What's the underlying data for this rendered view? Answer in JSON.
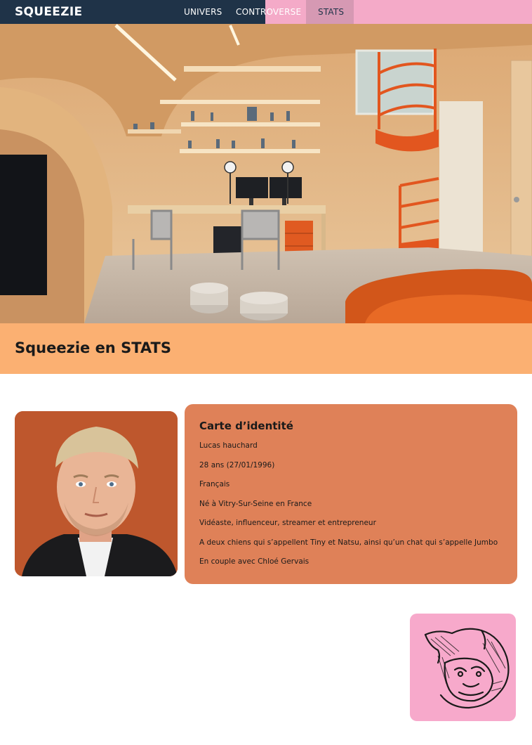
{
  "nav": {
    "brand": "SQUEEZIE",
    "links": [
      {
        "label": "UNIVERS"
      },
      {
        "label": "CONTROVERSE"
      },
      {
        "label": "STATS"
      }
    ],
    "active_link": "STATS"
  },
  "hero": {
    "image_alt": "room-photo"
  },
  "section": {
    "title": "Squeezie en STATS"
  },
  "id_card": {
    "heading": "Carte d’identité",
    "lines": [
      "Lucas hauchard",
      "28 ans (27/01/1996)",
      "Français",
      "Né à Vitry-Sur-Seine en France",
      "Vidéaste, influenceur, streamer et entrepreneur",
      "A deux chiens qui s’appellent Tiny et Natsu, ainsi qu’un chat qui s’appelle Jumbo",
      "En couple avec Chloé Gervais"
    ]
  },
  "colors": {
    "nav_bg": "#1f3348",
    "nav_pink": "#f4aac8",
    "band": "#fbb072",
    "card": "#df8158",
    "badge": "#f7a9cb"
  }
}
